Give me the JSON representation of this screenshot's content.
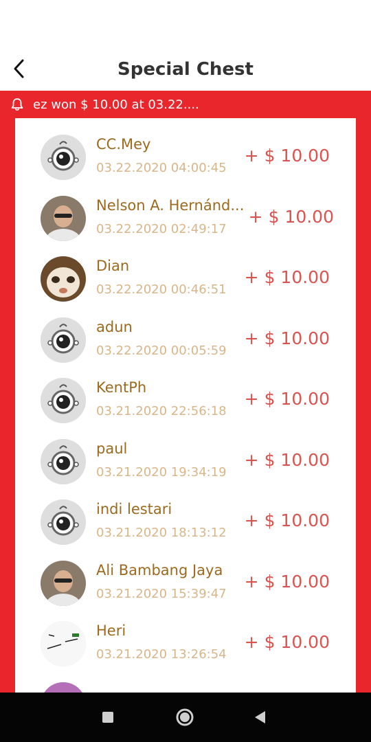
{
  "header": {
    "title": "Special Chest"
  },
  "ticker": {
    "text": "ez won $ 10.00 at 03.22...."
  },
  "entries": [
    {
      "name": "CC.Mey",
      "time": "03.22.2020 04:00:45",
      "amount": "+ $ 10.00",
      "avatar": "default-avatar-icon"
    },
    {
      "name": "Nelson A. Hernánd...",
      "time": "03.22.2020 02:49:17",
      "amount": "+ $ 10.00",
      "avatar": "photo"
    },
    {
      "name": "Dian",
      "time": "03.22.2020 00:46:51",
      "amount": "+ $ 10.00",
      "avatar": "cat-photo"
    },
    {
      "name": "adun",
      "time": "03.22.2020 00:05:59",
      "amount": "+ $ 10.00",
      "avatar": "default-avatar-icon"
    },
    {
      "name": "KentPh",
      "time": "03.21.2020 22:56:18",
      "amount": "+ $ 10.00",
      "avatar": "default-avatar-icon"
    },
    {
      "name": "paul",
      "time": "03.21.2020 19:34:19",
      "amount": "+ $ 10.00",
      "avatar": "default-avatar-icon"
    },
    {
      "name": "indi lestari",
      "time": "03.21.2020 18:13:12",
      "amount": "+ $ 10.00",
      "avatar": "default-avatar-icon"
    },
    {
      "name": "Ali Bambang Jaya",
      "time": "03.21.2020 15:39:47",
      "amount": "+ $ 10.00",
      "avatar": "photo"
    },
    {
      "name": "Heri",
      "time": "03.21.2020 13:26:54",
      "amount": "+ $ 10.00",
      "avatar": "sketch-photo"
    }
  ],
  "colors": {
    "accent_red": "#e8262c",
    "name": "#9c6a1e",
    "time": "#d8b68a",
    "amount": "#d9534f"
  }
}
